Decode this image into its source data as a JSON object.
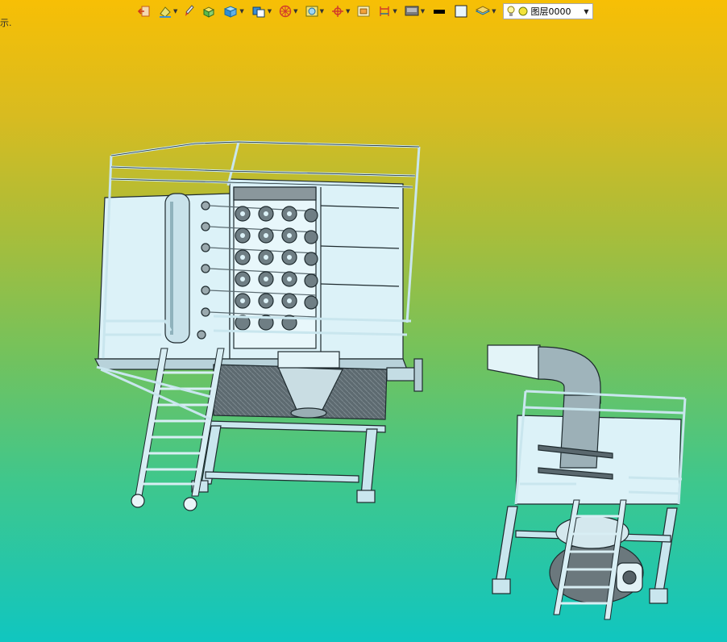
{
  "canvas": {
    "corner_text": "示.",
    "background_top": "#f7bf05",
    "background_bottom": "#10c6c0"
  },
  "toolbar": {
    "buttons": [
      {
        "icon": "exit-icon",
        "has_dropdown": false
      },
      {
        "icon": "paint-bucket-icon",
        "has_dropdown": true
      },
      {
        "icon": "brush-icon",
        "has_dropdown": false
      },
      {
        "icon": "box-green-icon",
        "has_dropdown": false
      },
      {
        "icon": "cube-blue-icon",
        "has_dropdown": true
      },
      {
        "icon": "cube-shaded-icon",
        "has_dropdown": true
      },
      {
        "icon": "section-wheel-icon",
        "has_dropdown": true
      },
      {
        "icon": "zoom-box-icon",
        "has_dropdown": true
      },
      {
        "icon": "crosshair-icon",
        "has_dropdown": true
      },
      {
        "icon": "frame-icon",
        "has_dropdown": false
      },
      {
        "icon": "dimension-icon",
        "has_dropdown": true
      },
      {
        "icon": "monitor-icon",
        "has_dropdown": true
      },
      {
        "icon": "line-black-icon",
        "has_dropdown": false
      },
      {
        "icon": "fill-white-icon",
        "has_dropdown": false
      },
      {
        "icon": "layers-icon",
        "has_dropdown": true
      }
    ],
    "layer_dropdown": {
      "value": "图层0000",
      "icons": [
        "lightbulb-icon",
        "sun-icon"
      ]
    }
  },
  "colors": {
    "steel": "#dcf2f8",
    "steel_dark": "#5b6a70",
    "outline": "#1e2a2e"
  }
}
